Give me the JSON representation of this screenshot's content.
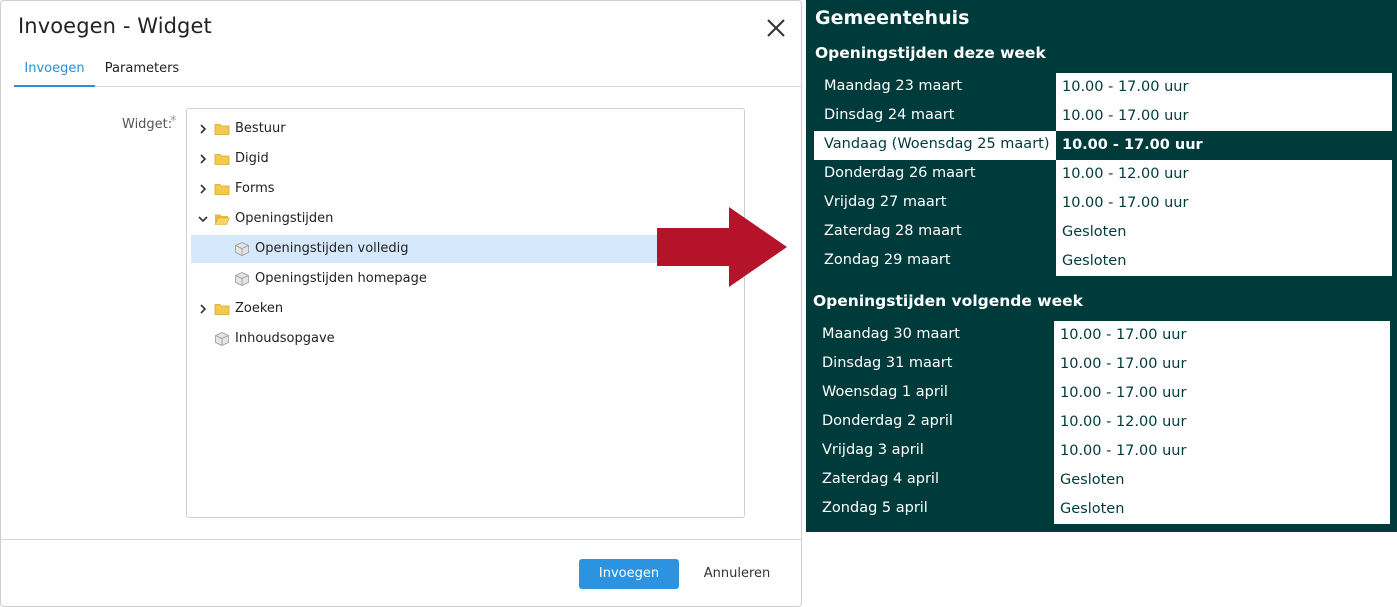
{
  "dialog": {
    "title": "Invoegen - Widget",
    "close_icon": "close-icon",
    "tabs": [
      {
        "label": "Invoegen",
        "active": true
      },
      {
        "label": "Parameters",
        "active": false
      }
    ],
    "field_label": "Widget:",
    "required_mark": "*",
    "tree": [
      {
        "label": "Bestuur",
        "type": "folder",
        "expanded": false
      },
      {
        "label": "Digid",
        "type": "folder",
        "expanded": false
      },
      {
        "label": "Forms",
        "type": "folder",
        "expanded": false
      },
      {
        "label": "Openingstijden",
        "type": "folder",
        "expanded": true
      },
      {
        "label": "Openingstijden volledig",
        "type": "widget",
        "selected": true
      },
      {
        "label": "Openingstijden homepage",
        "type": "widget",
        "selected": false
      },
      {
        "label": "Zoeken",
        "type": "folder",
        "expanded": false
      },
      {
        "label": "Inhoudsopgave",
        "type": "widget",
        "selected": false
      }
    ],
    "buttons": {
      "insert": "Invoegen",
      "cancel": "Annuleren"
    },
    "colors": {
      "accent": "#2b93e0",
      "selection": "#d6e8fb",
      "folder": "#f3c94f"
    }
  },
  "arrow": {
    "color": "#b5132a",
    "icon": "right-arrow-icon"
  },
  "hours": {
    "title": "Gemeentehuis",
    "this_week": {
      "heading": "Openingstijden deze week",
      "rows": [
        {
          "day": "Maandag 23 maart",
          "time": "10.00 - 17.00 uur"
        },
        {
          "day": "Dinsdag 24 maart",
          "time": "10.00 - 17.00 uur"
        },
        {
          "day": "Vandaag (Woensdag 25 maart)",
          "time": "10.00 - 17.00 uur",
          "today": true
        },
        {
          "day": "Donderdag 26 maart",
          "time": "10.00 - 12.00 uur"
        },
        {
          "day": "Vrijdag 27 maart",
          "time": "10.00 - 17.00 uur"
        },
        {
          "day": "Zaterdag 28 maart",
          "time": "Gesloten"
        },
        {
          "day": "Zondag 29 maart",
          "time": "Gesloten"
        }
      ]
    },
    "next_week": {
      "heading": "Openingstijden volgende week",
      "rows": [
        {
          "day": "Maandag 30 maart",
          "time": "10.00 - 17.00 uur"
        },
        {
          "day": "Dinsdag 31 maart",
          "time": "10.00 - 17.00 uur"
        },
        {
          "day": "Woensdag 1 april",
          "time": "10.00 - 17.00 uur"
        },
        {
          "day": "Donderdag 2 april",
          "time": "10.00 - 12.00 uur"
        },
        {
          "day": "Vrijdag 3 april",
          "time": "10.00 - 17.00 uur"
        },
        {
          "day": "Zaterdag 4 april",
          "time": "Gesloten"
        },
        {
          "day": "Zondag 5 april",
          "time": "Gesloten"
        }
      ]
    },
    "colors": {
      "background": "#003b3b",
      "cell": "#ffffff"
    }
  }
}
